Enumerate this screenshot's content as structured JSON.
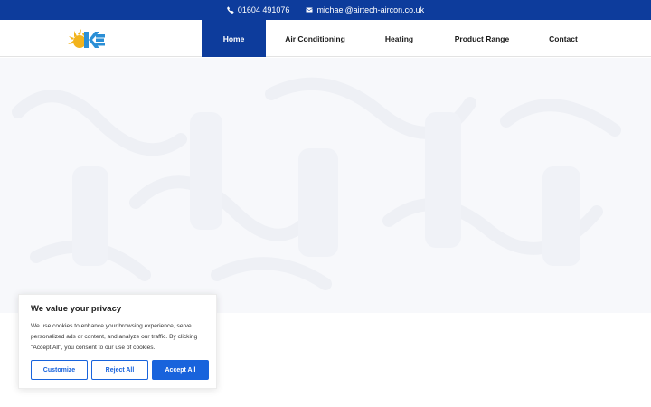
{
  "contact_bar": {
    "phone": "01604 491076",
    "email": "michael@airtech-aircon.co.uk"
  },
  "header": {
    "logo_icon": "airtech-logo-icon",
    "nav": [
      {
        "label": "Home",
        "active": true
      },
      {
        "label": "Air Conditioning",
        "active": false
      },
      {
        "label": "Heating",
        "active": false
      },
      {
        "label": "Product Range",
        "active": false
      },
      {
        "label": "Contact",
        "active": false
      }
    ]
  },
  "cookie_banner": {
    "title": "We value your privacy",
    "body": "We use cookies to enhance your browsing experience, serve personalized ads or content, and analyze our traffic. By clicking \"Accept All\", you consent to our use of cookies.",
    "customize_label": "Customize",
    "reject_label": "Reject All",
    "accept_label": "Accept All"
  },
  "colors": {
    "brand_blue": "#0d3c9c",
    "button_blue": "#1863dc"
  }
}
